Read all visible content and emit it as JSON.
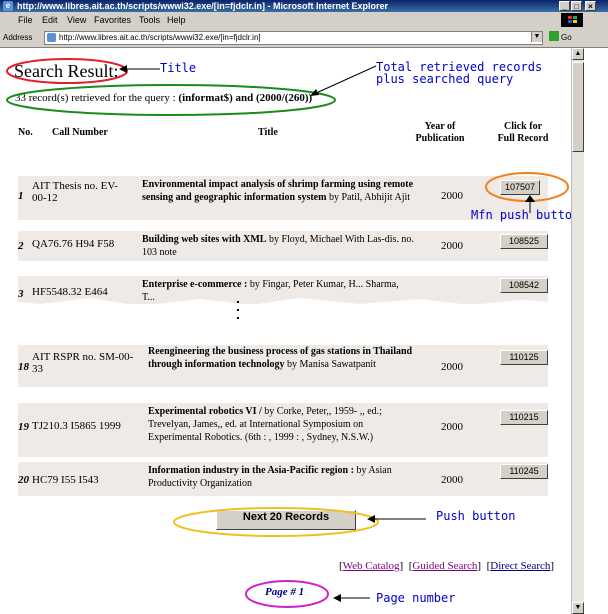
{
  "window": {
    "title": "http://www.libres.ait.ac.th/scripts/wwwi32.exe/[in=fjdclr.in] - Microsoft Internet Explorer",
    "min": "_",
    "max": "□",
    "close": "×"
  },
  "menu": [
    "File",
    "Edit",
    "View",
    "Favorites",
    "Tools",
    "Help"
  ],
  "address": {
    "label": "Address",
    "url": "http://www.libres.ait.ac.th/scripts/wwwi32.exe/[in=fjdclr.in]",
    "go": "Go"
  },
  "page": {
    "heading": "Search Result:",
    "summary_prefix": "33 record(s) retrieved for the query : ",
    "summary_query": "(informat$) and (2000/(260))",
    "columns": {
      "no": "No.",
      "call": "Call Number",
      "title": "Title",
      "year": "Year of Publication",
      "full": "Click for Full Record"
    },
    "records": [
      {
        "num": "1",
        "call": "AIT Thesis no. EV-00-12",
        "title": "Environmental impact analysis of shrimp farming using remote sensing and geographic information system",
        "author": "by Patil, Abhijit Ajit",
        "year": "2000",
        "mfn": "107507"
      },
      {
        "num": "2",
        "call": "QA76.76 H94 F58",
        "title": "Building web sites with XML",
        "author": "by Floyd, Michael With Las-dis. no. 103 note",
        "year": "2000",
        "mfn": "108525"
      },
      {
        "num": "3",
        "call": "HF5548.32 E464",
        "title": "Enterprise e-commerce :",
        "author": "by Fingar, Peter Kumar, H... Sharma, T...",
        "year": "",
        "mfn": "108542"
      },
      {
        "num": "18",
        "call": "AIT RSPR no. SM-00-33",
        "title": "Reengineering the business process of gas stations in Thailand through information technology",
        "author": "by Manisa Sawatpanit",
        "year": "2000",
        "mfn": "110125"
      },
      {
        "num": "19",
        "call": "TJ210.3 I5865 1999",
        "title": "Experimental robotics VI /",
        "author": "by Corke, Peter,, 1959- ,, ed.; Trevelyan, James,, ed. at International Symposium on Experimental Robotics. (6th : , 1999 : , Sydney, N.S.W.)",
        "year": "2000",
        "mfn": "110215"
      },
      {
        "num": "20",
        "call": "HC79 I55 I543",
        "title": "Information industry in the Asia-Pacific region :",
        "author": "by Asian Productivity Organization",
        "year": "2000",
        "mfn": "110245"
      }
    ],
    "next_button": "Next 20 Records",
    "links": [
      "Web Catalog",
      "Guided Search",
      "Direct Search"
    ],
    "page_label": "Page # 1"
  },
  "annotations": {
    "title": "Title",
    "total": "Total retrieved records plus searched query",
    "mfn": "Mfn push button",
    "push": "Push button",
    "pagenum": "Page number"
  },
  "colors": {
    "row_bg": "#efeae5",
    "annotation_text": "#0000cc",
    "title_oval": "#e0202a",
    "summary_oval": "#1a8c1a",
    "mfn_oval": "#f08020",
    "next_oval": "#f0c020",
    "page_oval": "#d020d0"
  }
}
